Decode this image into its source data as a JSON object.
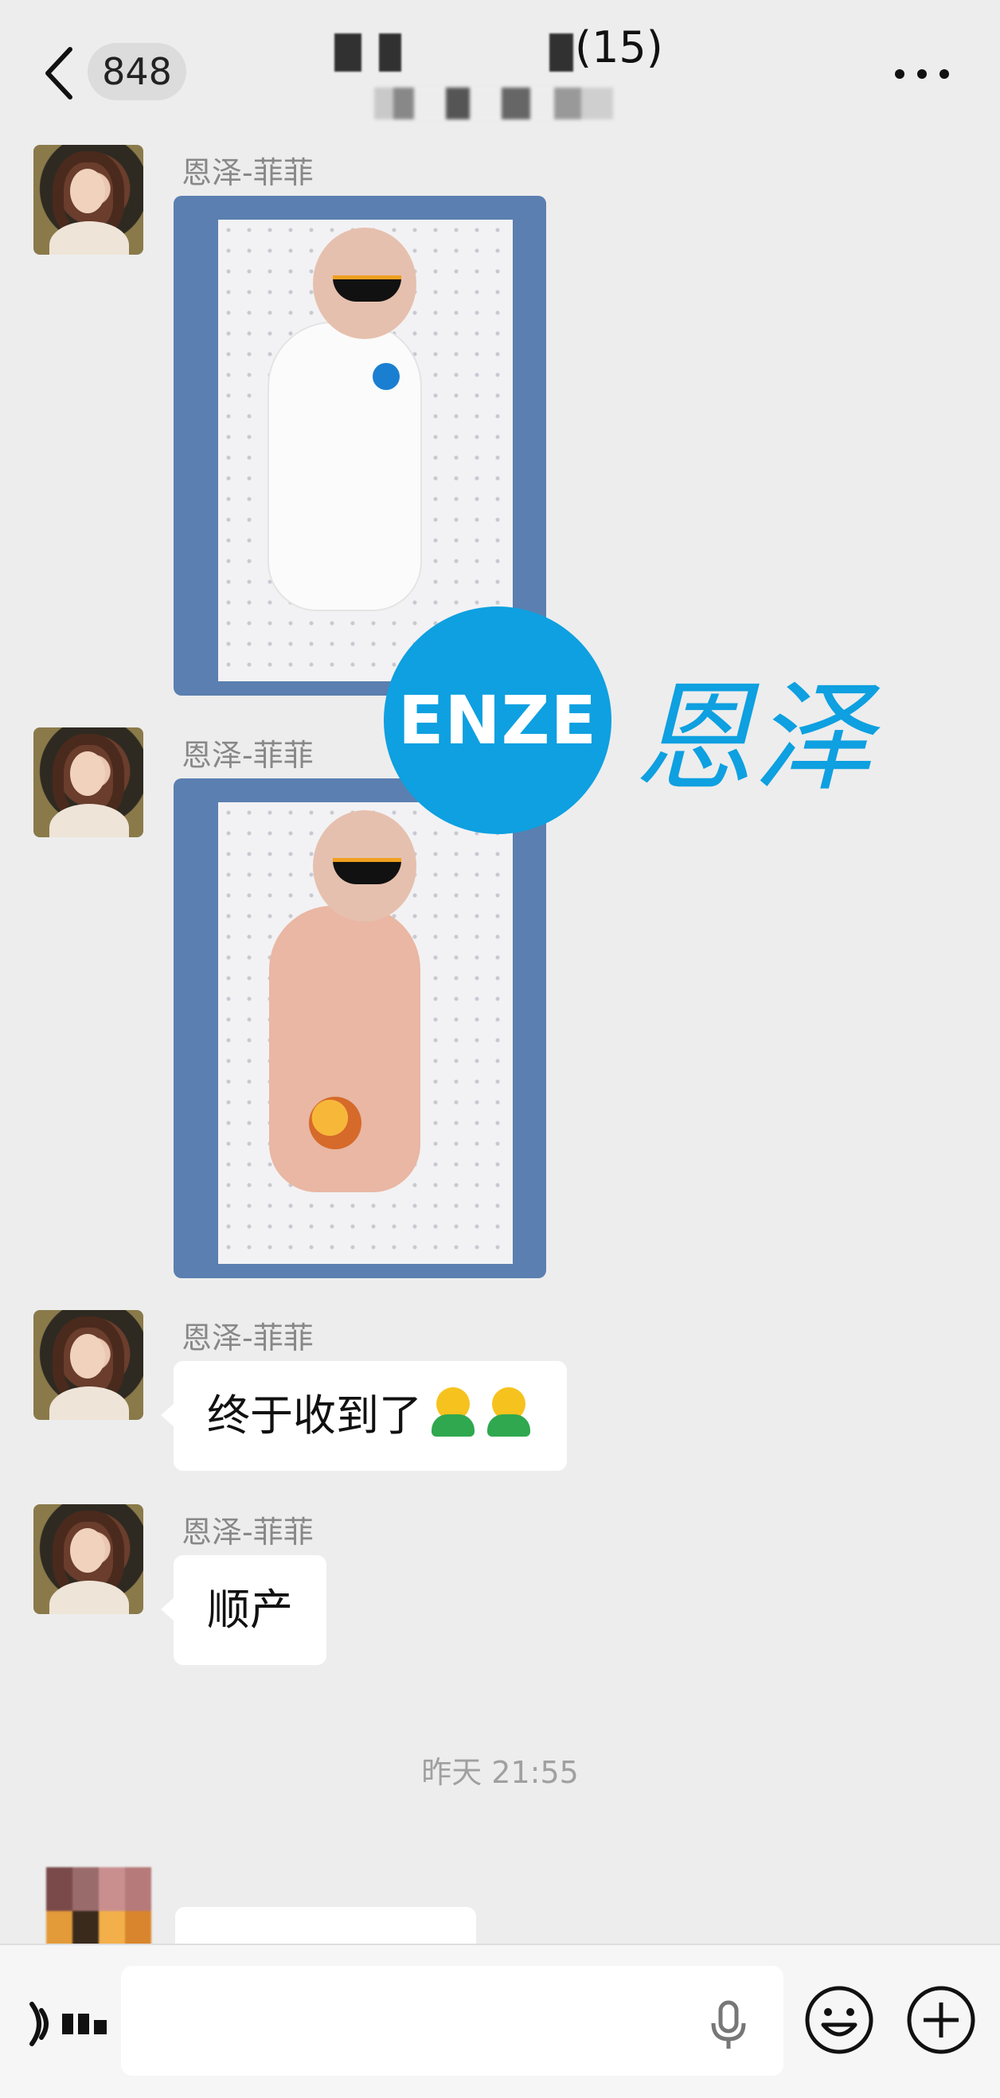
{
  "header": {
    "unread_count": "848",
    "group_member_count": "(15)"
  },
  "messages": [
    {
      "sender": "恩泽-菲菲",
      "type": "image"
    },
    {
      "sender": "恩泽-菲菲",
      "type": "image"
    },
    {
      "sender": "恩泽-菲菲",
      "type": "text",
      "text": "终于收到了",
      "emoji": [
        "smiling-figure-emoji",
        "smiling-figure-emoji"
      ]
    },
    {
      "sender": "恩泽-菲菲",
      "type": "text",
      "text": "顺产"
    }
  ],
  "timestamp": "昨天 21:55",
  "watermark": {
    "circle_text": "ENZE",
    "brand_text": "恩泽",
    "color": "#0ea0e0"
  },
  "input_bar": {
    "placeholder": "",
    "icons": [
      "voice-icon",
      "mic-icon",
      "emoji-icon",
      "plus-icon"
    ]
  },
  "colors": {
    "background": "#ededed",
    "bubble": "#ffffff",
    "sender_text": "#888888"
  }
}
